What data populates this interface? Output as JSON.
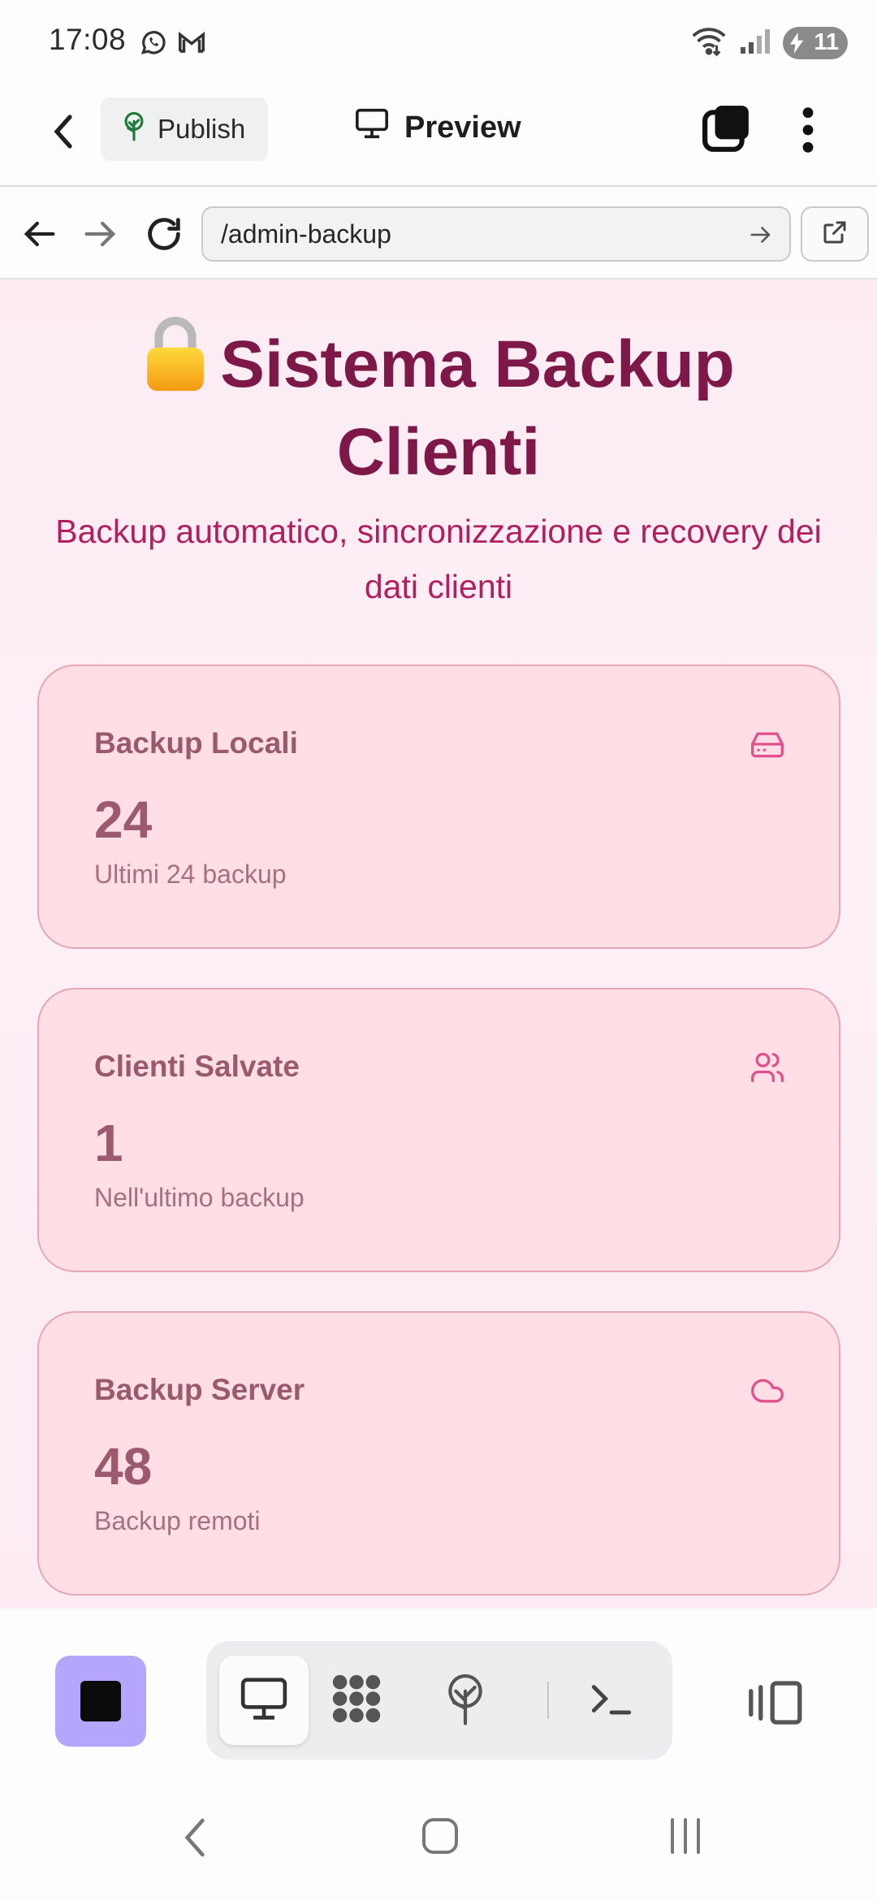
{
  "status_bar": {
    "time": "17:08",
    "app_icons": [
      "whatsapp-icon",
      "gmail-icon"
    ],
    "system_icons": [
      "wifi-icon",
      "signal-icon"
    ],
    "battery_level": "11"
  },
  "app_bar": {
    "publish_label": "Publish",
    "preview_label": "Preview"
  },
  "url_bar": {
    "url": "/admin-backup"
  },
  "page": {
    "title_icon": "lock-icon",
    "title": "Sistema Backup Clienti",
    "subtitle": "Backup automatico, sincronizzazione e recovery dei dati clienti",
    "cards": [
      {
        "label": "Backup Locali",
        "value": "24",
        "note": "Ultimi 24 backup",
        "icon": "hard-drive-icon"
      },
      {
        "label": "Clienti Salvate",
        "value": "1",
        "note": "Nell'ultimo backup",
        "icon": "users-icon"
      },
      {
        "label": "Backup Server",
        "value": "48",
        "note": "Backup remoti",
        "icon": "cloud-icon"
      }
    ]
  },
  "colors": {
    "title": "#7d1848",
    "subtitle": "#b0205e",
    "card_bg": "#ffdfe5",
    "card_border": "#e5a6b6",
    "accent_icon": "#e0508c",
    "stop_button": "#b5a6fb"
  },
  "bottom_toolbar": {
    "tools": [
      "monitor-icon",
      "apps-grid-icon",
      "publish-tree-icon",
      "terminal-icon"
    ],
    "active_tool": "monitor-icon"
  }
}
